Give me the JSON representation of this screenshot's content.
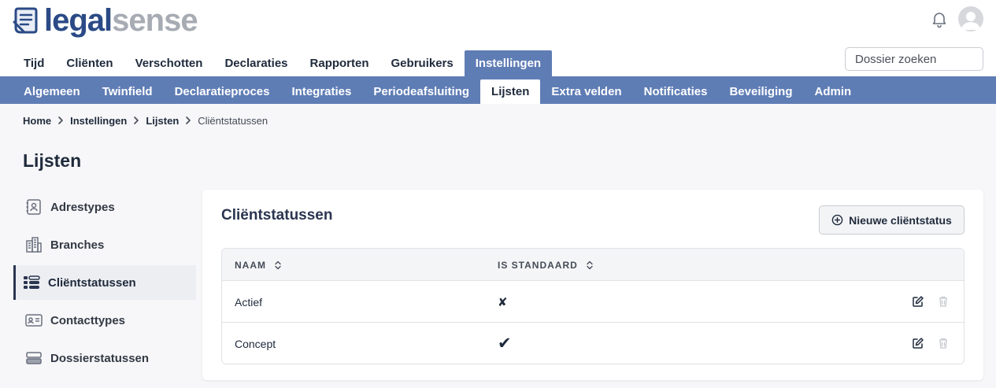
{
  "logo": {
    "part1": "legal",
    "part2": "sense"
  },
  "header": {
    "bell_icon": "bell-icon",
    "avatar_icon": "user-avatar-icon",
    "search": {
      "placeholder": "Dossier zoeken",
      "value": ""
    }
  },
  "mainnav": {
    "tabs": [
      {
        "label": "Tijd"
      },
      {
        "label": "Cliënten"
      },
      {
        "label": "Verschotten"
      },
      {
        "label": "Declaraties"
      },
      {
        "label": "Rapporten"
      },
      {
        "label": "Gebruikers"
      },
      {
        "label": "Instellingen",
        "active": true
      }
    ]
  },
  "subnav": {
    "tabs": [
      {
        "label": "Algemeen"
      },
      {
        "label": "Twinfield"
      },
      {
        "label": "Declaratieproces"
      },
      {
        "label": "Integraties"
      },
      {
        "label": "Periodeafsluiting"
      },
      {
        "label": "Lijsten",
        "active": true
      },
      {
        "label": "Extra velden"
      },
      {
        "label": "Notificaties"
      },
      {
        "label": "Beveiliging"
      },
      {
        "label": "Admin"
      }
    ]
  },
  "breadcrumb": [
    "Home",
    "Instellingen",
    "Lijsten",
    "Cliëntstatussen"
  ],
  "page_title": "Lijsten",
  "sidebar": {
    "items": [
      {
        "label": "Adrestypes",
        "icon": "address-book-icon"
      },
      {
        "label": "Branches",
        "icon": "buildings-icon"
      },
      {
        "label": "Cliëntstatussen",
        "icon": "status-list-icon",
        "active": true
      },
      {
        "label": "Contacttypes",
        "icon": "contact-card-icon"
      },
      {
        "label": "Dossierstatussen",
        "icon": "server-stack-icon"
      }
    ]
  },
  "card": {
    "title": "Cliëntstatussen",
    "new_button": "Nieuwe cliëntstatus",
    "table": {
      "columns": [
        "NAAM",
        "IS STANDAARD"
      ],
      "rows": [
        {
          "naam": "Actief",
          "is_standaard": "✘"
        },
        {
          "naam": "Concept",
          "is_standaard": "✔"
        }
      ]
    }
  },
  "colors": {
    "accent": "#5f7db5",
    "logo_primary": "#2b4a86",
    "logo_secondary": "#a7abb3",
    "text": "#1f2a3c"
  }
}
